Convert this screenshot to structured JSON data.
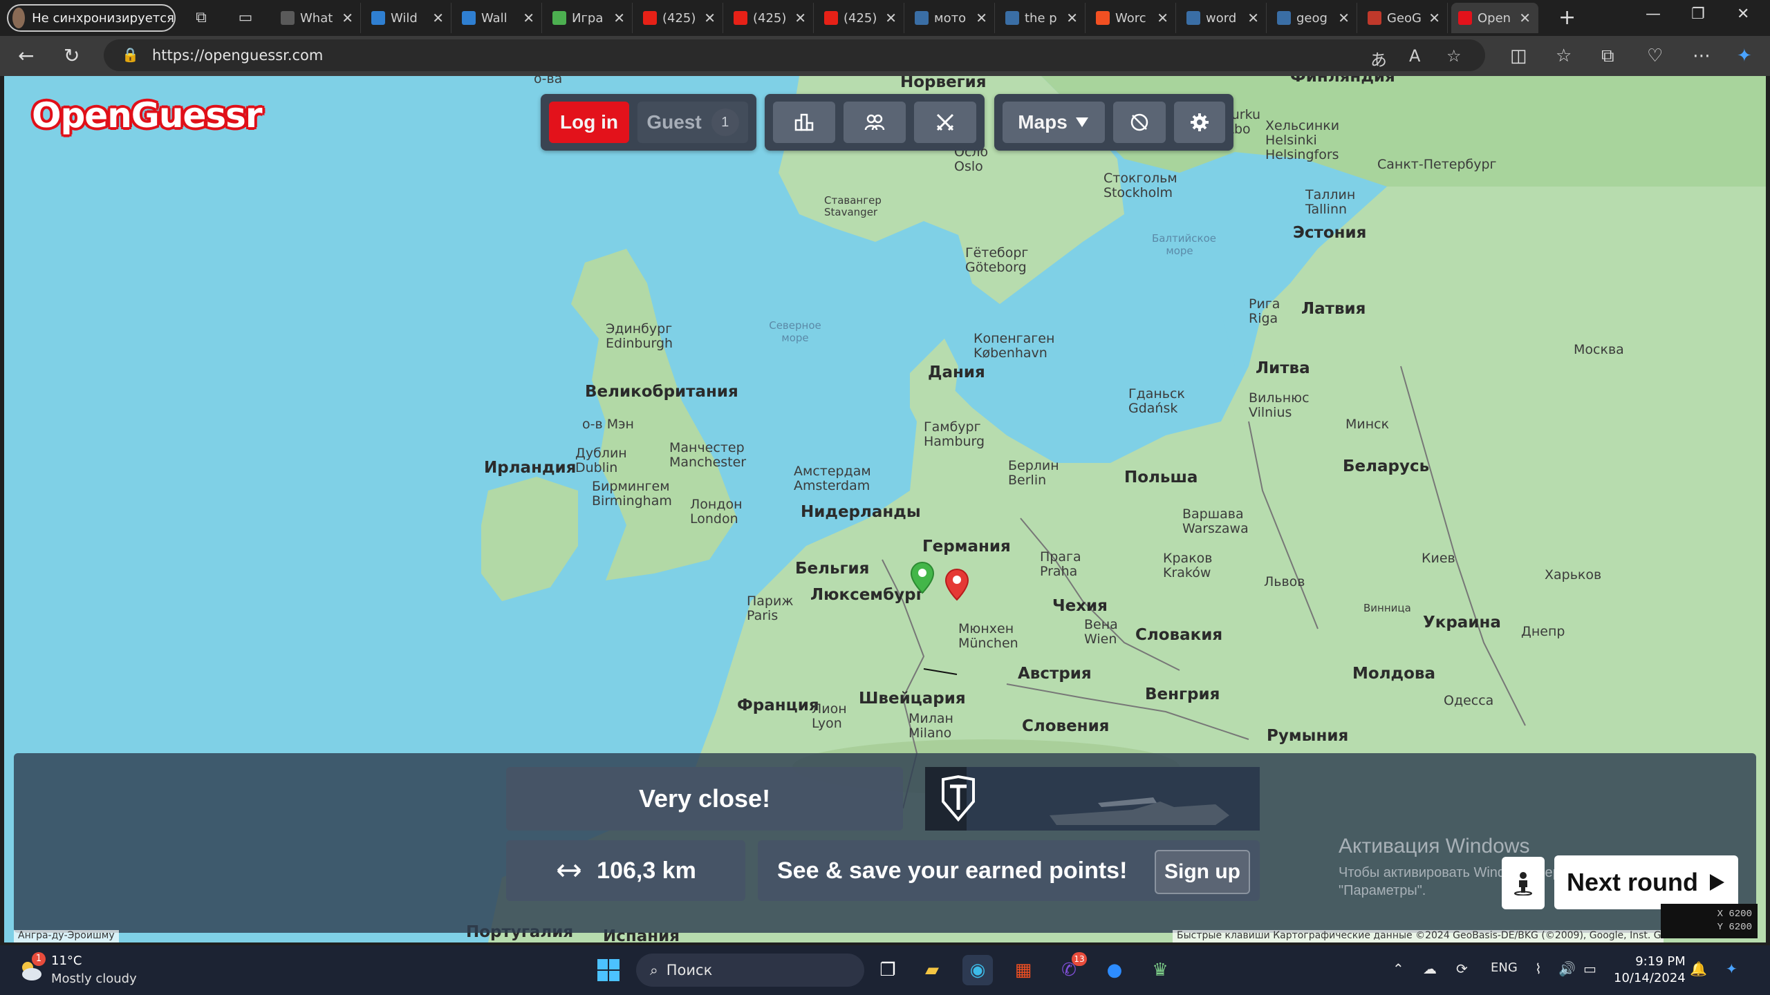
{
  "browser": {
    "profile_label": "Не синхронизируется",
    "tabs": [
      {
        "label": "What",
        "fav": "#5a5a5a"
      },
      {
        "label": "Wild",
        "fav": "#2f7fd1"
      },
      {
        "label": "Wall",
        "fav": "#2f7fd1"
      },
      {
        "label": "Игра",
        "fav": "#4caf50"
      },
      {
        "label": "(425)",
        "fav": "#e62117"
      },
      {
        "label": "(425)",
        "fav": "#e62117"
      },
      {
        "label": "(425)",
        "fav": "#e62117"
      },
      {
        "label": "мото",
        "fav": "#3a6ea5"
      },
      {
        "label": "the p",
        "fav": "#3a6ea5"
      },
      {
        "label": "Worc",
        "fav": "#f25022"
      },
      {
        "label": "word",
        "fav": "#3a6ea5"
      },
      {
        "label": "geog",
        "fav": "#3a6ea5"
      },
      {
        "label": "GeoG",
        "fav": "#c0392b"
      },
      {
        "label": "Open",
        "fav": "#e3121b"
      }
    ],
    "url": "https://openguessr.com"
  },
  "game": {
    "logo": "OpenGuessr",
    "login_label": "Log in",
    "guest_label": "Guest",
    "guest_count": "1",
    "maps_label": "Maps",
    "result_text": "Very close!",
    "distance_text": "106,3 km",
    "signup_prompt": "See & save your earned points!",
    "signup_label": "Sign up",
    "next_round_label": "Next round",
    "icons": [
      "leaderboard-icon",
      "multiplayer-icon",
      "battle-icon",
      "maps-dropdown-icon",
      "no-compass-icon",
      "settings-icon",
      "street-view-icon",
      "play-icon",
      "distance-arrows-icon"
    ],
    "accent_red": "#e3121b",
    "guess_marker_color": "#e53935",
    "actual_marker_color": "#43b649"
  },
  "map": {
    "countries": [
      "Норвегия",
      "Финляндия",
      "Дания",
      "Великобритания",
      "Ирландия",
      "Эстония",
      "Латвия",
      "Литва",
      "Польша",
      "Беларусь",
      "Германия",
      "Нидерланды",
      "Бельгия",
      "Люксембург",
      "Франция",
      "Швейцария",
      "Австрия",
      "Чехия",
      "Словакия",
      "Венгрия",
      "Словения",
      "Румыния",
      "Молдова",
      "Украина",
      "Португалия",
      "Испания"
    ],
    "cities": [
      "Осло Oslo",
      "Стокгольм Stockholm",
      "Хельсинки Helsinki Helsingfors",
      "Санкт-Петербург",
      "Таллин Tallinn",
      "Ставангер Stavanger",
      "Гётеборг Göteborg",
      "Эдинбург Edinburgh",
      "Копенгаген København",
      "Рига Riga",
      "Москва",
      "о-в Мэн",
      "Дублин Dublin",
      "Манчестер Manchester",
      "Бирмингем Birmingham",
      "Лондон London",
      "Амстердам Amsterdam",
      "Гамбург Hamburg",
      "Берлин Berlin",
      "Гданьск Gdańsk",
      "Вильнюс Vilnius",
      "Минск",
      "Варшава Warszawa",
      "Париж Paris",
      "Прага Praha",
      "Краков Kraków",
      "Львов",
      "Киев",
      "Харьков",
      "Мюнхен München",
      "Вена Wien",
      "Лион Lyon",
      "Милан Milano",
      "Винница",
      "Днепр",
      "Одесса",
      "о-ва",
      "Turku Åbo"
    ],
    "seas": [
      "Северное море",
      "Балтийское море"
    ],
    "attribution_left": "Ангра-ду-Эроишму",
    "attribution_right": "Быстрые клавиши   Картографические данные ©2024 GeoBasis-DE/BKG (©2009), Google, Inst. Geo"
  },
  "windows": {
    "activation_title": "Активация Windows",
    "activation_sub": "Чтобы активировать Windows, перейдите в раздел \"Параметры\".",
    "coords_x": "X 6200",
    "coords_y": "Y 6200"
  },
  "taskbar": {
    "weather_temp": "11°C",
    "weather_cond": "Mostly cloudy",
    "weather_badge": "1",
    "search_placeholder": "Поиск",
    "viber_badge": "13",
    "lang": "ENG",
    "time": "9:19 PM",
    "date": "10/14/2024"
  }
}
